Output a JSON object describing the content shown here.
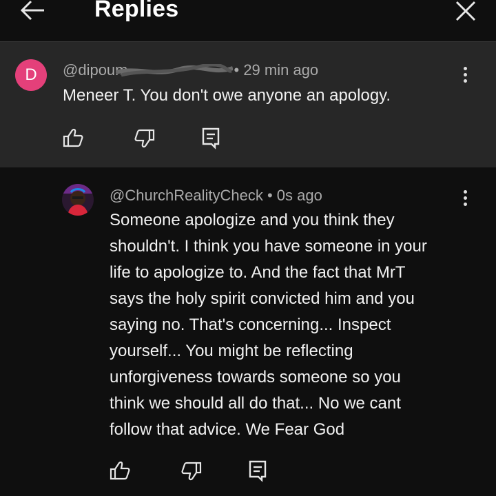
{
  "header": {
    "title": "Replies",
    "back_icon": "arrow-left-icon",
    "close_icon": "close-icon"
  },
  "parent_comment": {
    "avatar_letter": "D",
    "avatar_color": "#e4407a",
    "author": "@dipoum",
    "time": "• 29 min ago",
    "text": "Meneer T. You don't owe anyone an apology."
  },
  "reply_comment": {
    "author": "@ChurchRealityCheck",
    "time": "• 0s ago",
    "lines": [
      "Someone apologize and you think they",
      "shouldn't. I think you have someone in your",
      "life to apologize to. And the fact that MrT",
      "says the holy spirit convicted him and you",
      "saying no. That's concerning...  Inspect",
      "yourself... You might be reflecting",
      "unforgiveness towards someone so you",
      "think we should all do that... No we cant",
      "follow that advice. We Fear God"
    ]
  },
  "colors": {
    "bg": "#0f0f0f",
    "parent_bg": "#272727",
    "meta": "#aaaaaa",
    "text": "#f1f1f1"
  }
}
